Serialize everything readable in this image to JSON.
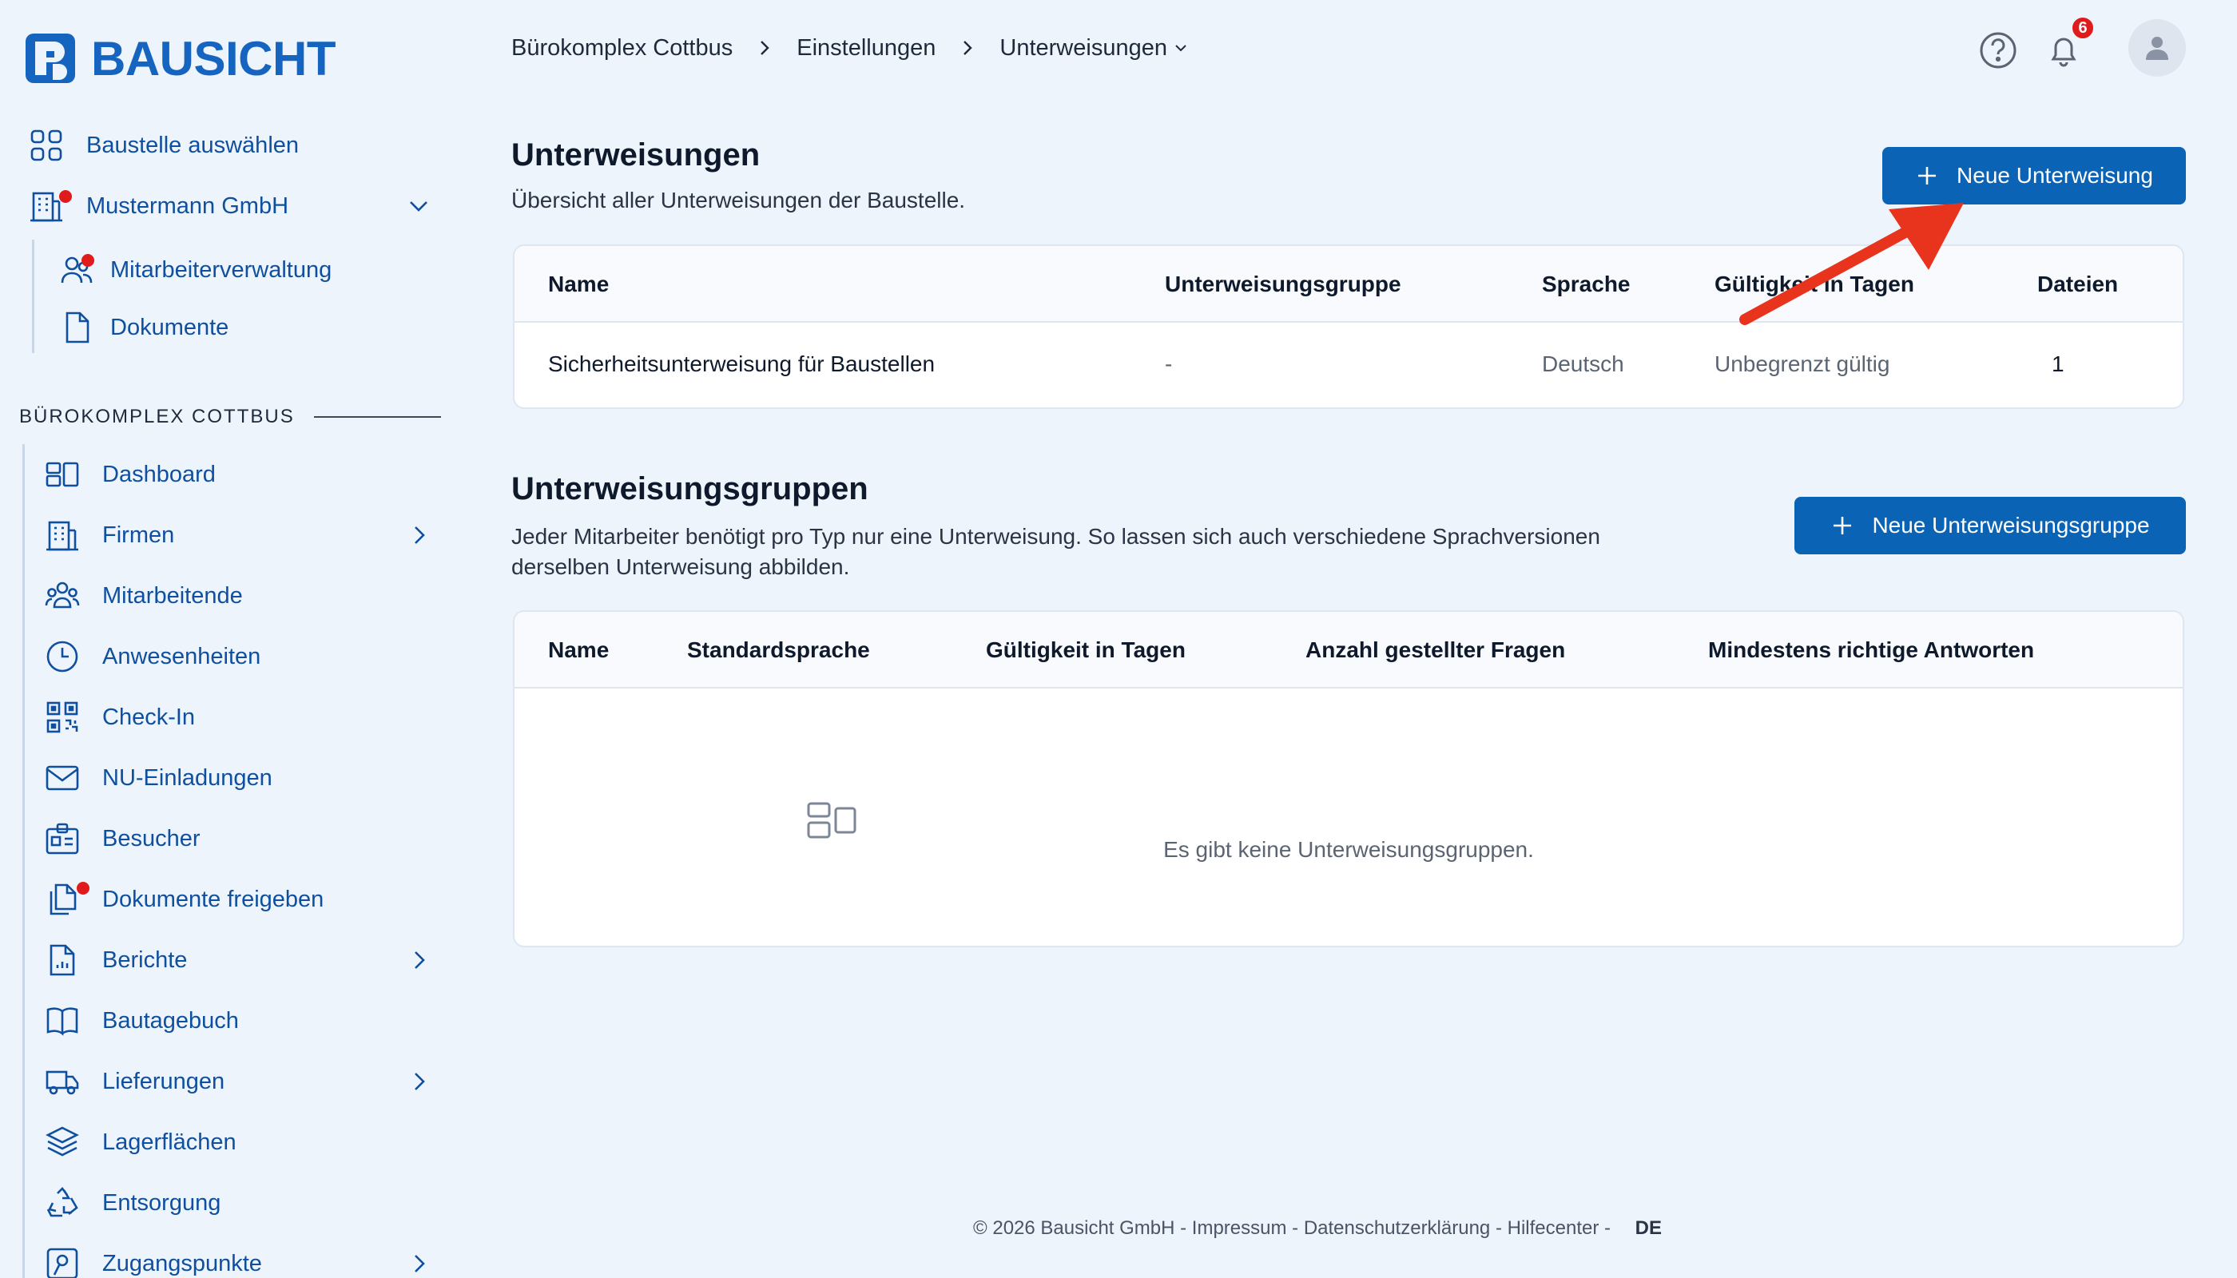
{
  "brand": {
    "name": "BAUSICHT"
  },
  "sidebar": {
    "top_items": [
      {
        "label": "Baustelle auswählen",
        "icon": "grid-icon"
      },
      {
        "label": "Mustermann GmbH",
        "icon": "building-icon",
        "has_notification": true,
        "expanded": true
      }
    ],
    "company_subitems": [
      {
        "label": "Mitarbeiterverwaltung",
        "icon": "users-icon",
        "has_notification": true
      },
      {
        "label": "Dokumente",
        "icon": "document-icon"
      }
    ],
    "section_title": "BÜROKOMPLEX COTTBUS",
    "section_items": [
      {
        "label": "Dashboard",
        "icon": "dashboard-icon"
      },
      {
        "label": "Firmen",
        "icon": "building-icon",
        "has_submenu": true
      },
      {
        "label": "Mitarbeitende",
        "icon": "people-icon"
      },
      {
        "label": "Anwesenheiten",
        "icon": "clock-icon"
      },
      {
        "label": "Check-In",
        "icon": "qr-code-icon"
      },
      {
        "label": "NU-Einladungen",
        "icon": "mail-icon"
      },
      {
        "label": "Besucher",
        "icon": "id-badge-icon"
      },
      {
        "label": "Dokumente freigeben",
        "icon": "documents-icon",
        "has_notification": true
      },
      {
        "label": "Berichte",
        "icon": "report-icon",
        "has_submenu": true
      },
      {
        "label": "Bautagebuch",
        "icon": "book-icon"
      },
      {
        "label": "Lieferungen",
        "icon": "truck-icon",
        "has_submenu": true
      },
      {
        "label": "Lagerflächen",
        "icon": "layers-icon"
      },
      {
        "label": "Entsorgung",
        "icon": "recycle-icon"
      },
      {
        "label": "Zugangspunkte",
        "icon": "access-point-icon",
        "has_submenu": true
      }
    ]
  },
  "header": {
    "breadcrumb": [
      "Bürokomplex Cottbus",
      "Einstellungen",
      "Unterweisungen"
    ],
    "notification_count": "6"
  },
  "instructions": {
    "title": "Unterweisungen",
    "description": "Übersicht aller Unterweisungen der Baustelle.",
    "new_button": "Neue Unterweisung",
    "columns": [
      "Name",
      "Unterweisungsgruppe",
      "Sprache",
      "Gültigkeit in Tagen",
      "Dateien"
    ],
    "rows": [
      {
        "name": "Sicherheitsunterweisung für Baustellen",
        "group": "-",
        "language": "Deutsch",
        "validity": "Unbegrenzt gültig",
        "files": "1"
      }
    ]
  },
  "groups": {
    "title": "Unterweisungsgruppen",
    "description_line1": "Jeder Mitarbeiter benötigt pro Typ nur eine Unterweisung. So lassen sich auch verschiedene Sprachversionen",
    "description_line2": "derselben Unterweisung abbilden.",
    "new_button": "Neue Unterweisungsgruppe",
    "columns": [
      "Name",
      "Standardsprache",
      "Gültigkeit in Tagen",
      "Anzahl gestellter Fragen",
      "Mindestens richtige Antworten"
    ],
    "empty_text": "Es gibt keine Unterweisungsgruppen."
  },
  "footer": {
    "copyright": "© 2026 Bausicht GmbH",
    "links": [
      "Impressum",
      "Datenschutzerklärung",
      "Hilfecenter"
    ],
    "separator": " - ",
    "language": "DE"
  },
  "colors": {
    "brand": "#1565c0",
    "primary_button": "#0b63b5",
    "notification": "#e01b1b",
    "annotation_arrow": "#e8341c"
  }
}
